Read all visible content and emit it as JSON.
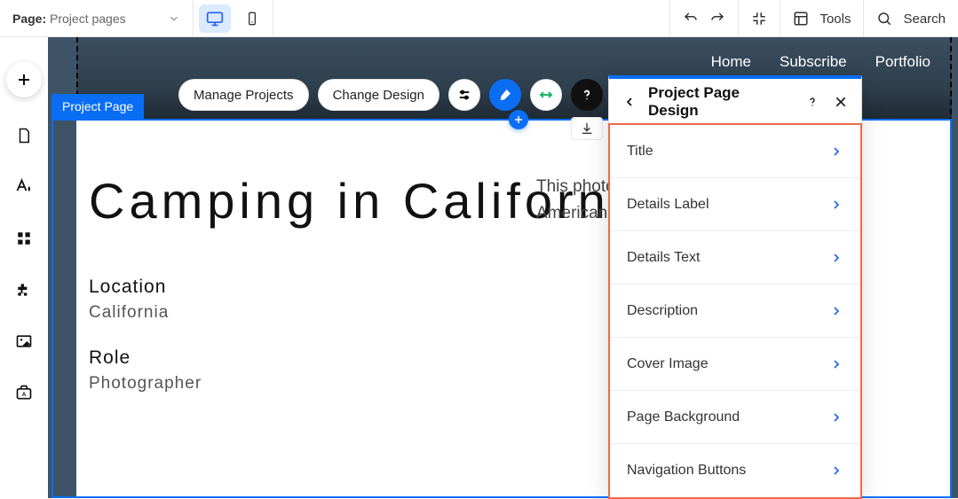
{
  "topbar": {
    "page_label_prefix": "Page:",
    "page_name": "Project pages",
    "tools_label": "Tools",
    "search_label": "Search"
  },
  "site_nav": [
    "Home",
    "Subscribe",
    "Portfolio"
  ],
  "selection_tag": "Project Page",
  "element_toolbar": {
    "manage_label": "Manage Projects",
    "change_design_label": "Change Design"
  },
  "page": {
    "title": "Camping in California",
    "meta": [
      {
        "label": "Location",
        "value": "California"
      },
      {
        "label": "Role",
        "value": "Photographer"
      }
    ],
    "description_visible": "This photo series focuses on camping in American wilderness and nature."
  },
  "design_panel": {
    "title": "Project Page Design",
    "rows": [
      "Title",
      "Details Label",
      "Details Text",
      "Description",
      "Cover Image",
      "Page Background",
      "Navigation Buttons"
    ]
  }
}
